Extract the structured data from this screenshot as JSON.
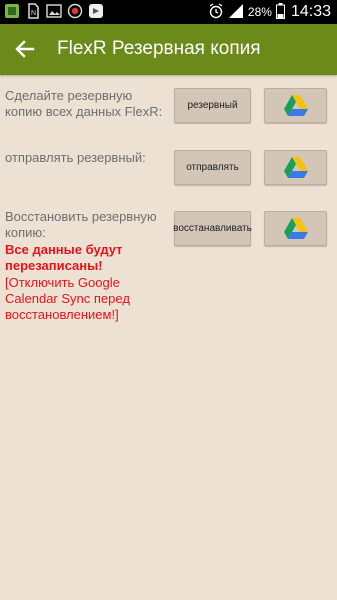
{
  "status_bar": {
    "battery": "28%",
    "time": "14:33"
  },
  "app_bar": {
    "title": "FlexR Резервная копия"
  },
  "rows": [
    {
      "label": "Сделайте резервную копию всех данных FlexR:",
      "button_label": "резервный"
    },
    {
      "label": "отправлять резервный:",
      "button_label": "отправлять"
    },
    {
      "label": "Восстановить резервную копию:",
      "button_label": "восстанавливать"
    }
  ],
  "restore_warning": {
    "bold": "Все данные будут перезаписаны!",
    "note": "[Отключить Google Calendar Sync перед восстановлением!]"
  },
  "colors": {
    "app_bar": "#6b8a1a",
    "background": "#ece1d3",
    "button": "#d3c6b7",
    "warning": "#e8131a"
  }
}
